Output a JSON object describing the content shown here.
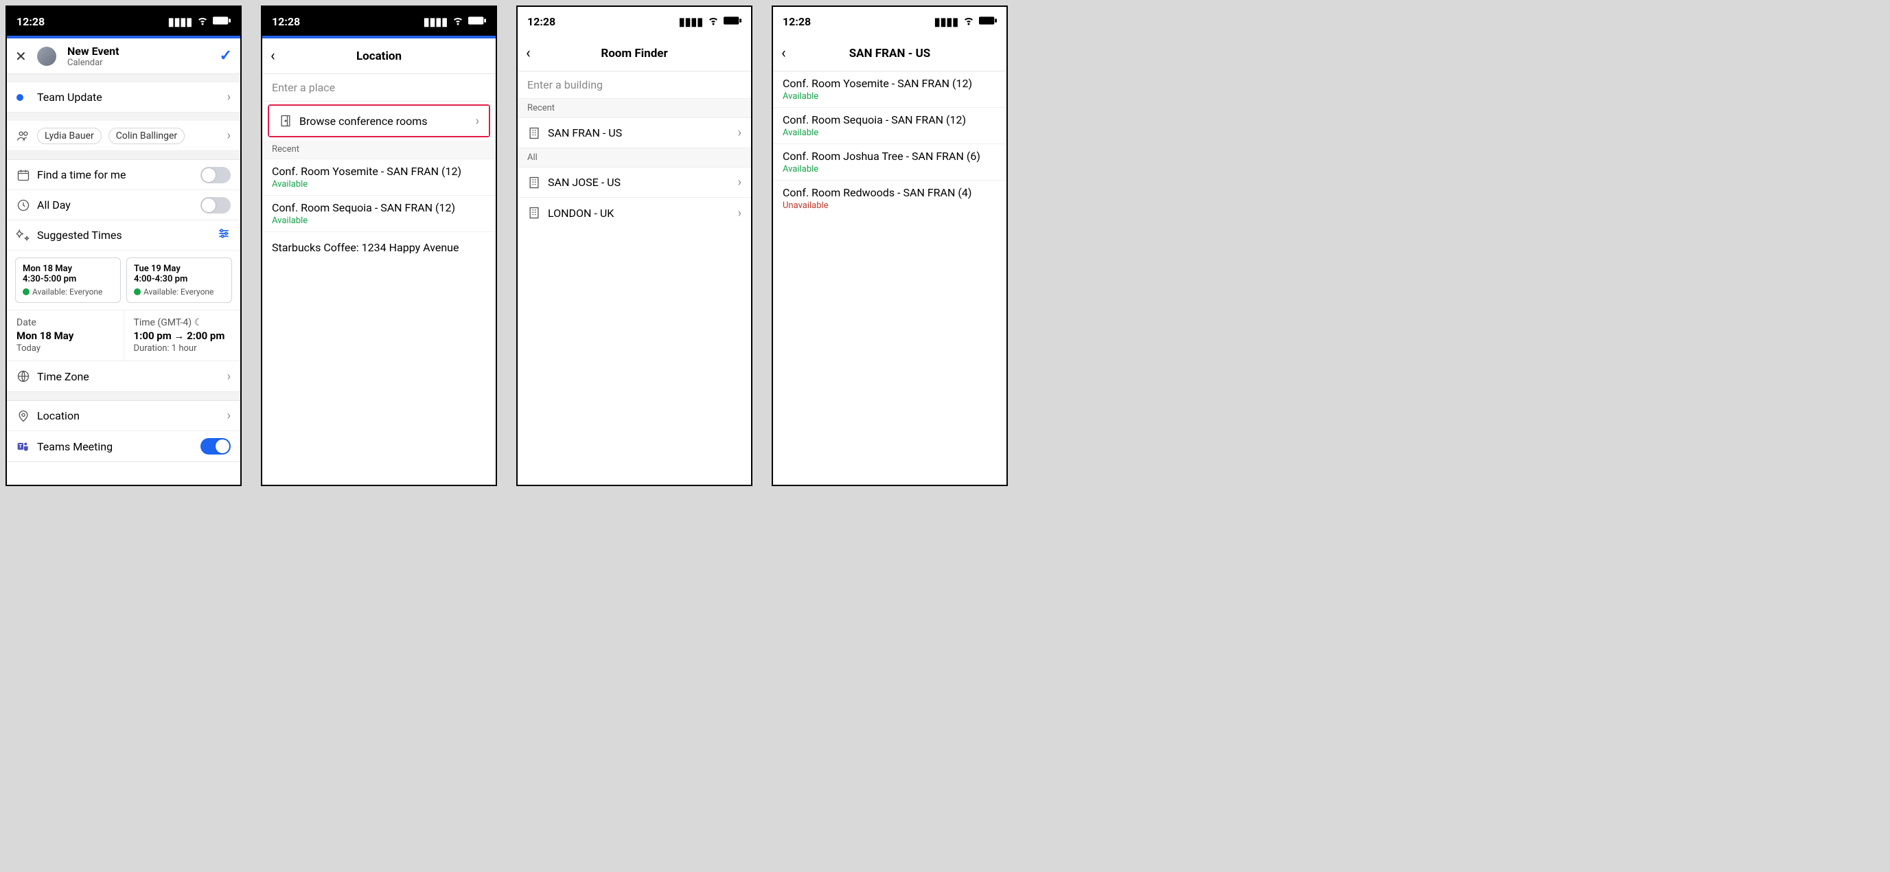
{
  "status_time": "12:28",
  "screen1": {
    "header_title": "New Event",
    "header_sub": "Calendar",
    "event_title": "Team Update",
    "attendees": [
      "Lydia Bauer",
      "Colin Ballinger"
    ],
    "find_time": "Find a time for me",
    "all_day": "All Day",
    "suggested_label": "Suggested Times",
    "suggestions": [
      {
        "date": "Mon 18 May",
        "time": "4:30-5:00 pm",
        "avail": "Available: Everyone"
      },
      {
        "date": "Tue 19 May",
        "time": "4:00-4:30 pm",
        "avail": "Available: Everyone"
      }
    ],
    "date_label": "Date",
    "date_value": "Mon 18 May",
    "date_sub": "Today",
    "time_label": "Time (GMT-4)",
    "time_value": "1:00 pm → 2:00 pm",
    "time_sub": "Duration: 1 hour",
    "timezone": "Time Zone",
    "location": "Location",
    "teams_meeting": "Teams Meeting"
  },
  "screen2": {
    "title": "Location",
    "placeholder": "Enter a place",
    "browse": "Browse conference rooms",
    "recent_label": "Recent",
    "recent": [
      {
        "name": "Conf. Room Yosemite - SAN FRAN (12)",
        "status": "Available"
      },
      {
        "name": "Conf. Room Sequoia - SAN FRAN (12)",
        "status": "Available"
      },
      {
        "name": "Starbucks Coffee: 1234 Happy Avenue",
        "status": ""
      }
    ]
  },
  "screen3": {
    "title": "Room Finder",
    "placeholder": "Enter a building",
    "recent_label": "Recent",
    "recent": [
      "SAN FRAN - US"
    ],
    "all_label": "All",
    "all": [
      "SAN JOSE - US",
      "LONDON - UK"
    ]
  },
  "screen4": {
    "title": "SAN FRAN - US",
    "rooms": [
      {
        "name": "Conf. Room Yosemite - SAN FRAN (12)",
        "status": "Available",
        "avail": true
      },
      {
        "name": "Conf. Room Sequoia - SAN FRAN (12)",
        "status": "Available",
        "avail": true
      },
      {
        "name": "Conf. Room Joshua Tree - SAN FRAN (6)",
        "status": "Available",
        "avail": true
      },
      {
        "name": "Conf. Room Redwoods - SAN FRAN (4)",
        "status": "Unavailable",
        "avail": false
      }
    ]
  }
}
